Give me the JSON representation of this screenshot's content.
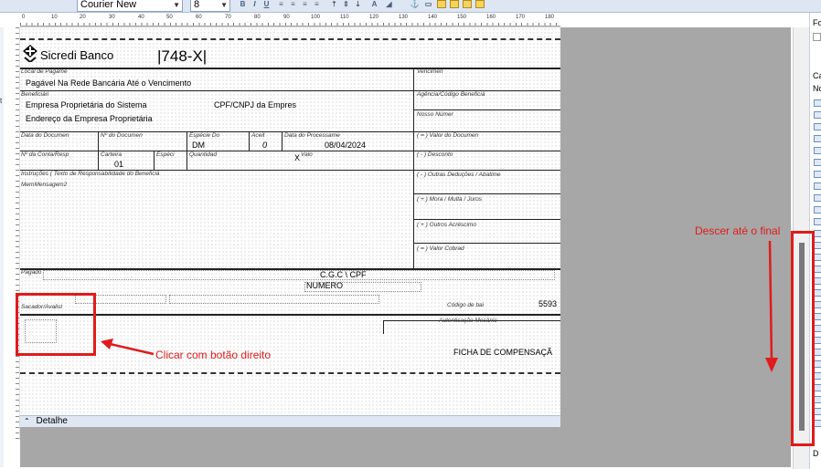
{
  "toolbar": {
    "font_name": "Courier New",
    "font_size": "8",
    "buttons": [
      "B",
      "I",
      "U"
    ]
  },
  "ruler": {
    "horizontal_ticks": [
      "0",
      "10",
      "20",
      "30",
      "40",
      "50",
      "60",
      "70",
      "80",
      "90",
      "100",
      "110",
      "120",
      "130",
      "140",
      "150",
      "160",
      "170",
      "180",
      "190",
      "200"
    ]
  },
  "boleto": {
    "bank_name": "Sicredi Banco",
    "bank_code": "|748-X|",
    "local_pagamento_label": "Local de Pagame",
    "local_pagamento_value": "Pagável Na Rede Bancária Até o Vencimento",
    "vencimento_label": "Vencimen",
    "beneficiario_label": "Beneficiári",
    "beneficiario_value": "Empresa Proprietária do Sistema",
    "cpf_cnpj_value": "CPF/CNPJ da Empres",
    "agencia_label": "Agência/Código Beneficiá",
    "endereco_value": "Endereço da Empresa Proprietária",
    "nosso_numero_label": "Nosso Númer",
    "data_documento_label": "Data do Documen",
    "num_documento_label": "Nº do Documen",
    "especie_doc_label": "Espécie Do",
    "especie_doc_value": "DM",
    "aceite_label": "Aceit",
    "aceite_value": "0",
    "data_processamento_label": "Data do Processame",
    "data_processamento_value": "08/04/2024",
    "valor_documento_label": "( = ) Valor do Documen",
    "conta_label": "Nº da Conta/Resp",
    "carteira_label": "Carteira",
    "carteira_value": "01",
    "especie_label": "Espéci",
    "quantidade_label": "Quantidad",
    "valor_label": "Valo",
    "valor_x": "X",
    "desconto_label": "( - ) Desconto",
    "instrucoes_label": "Instruções   ( Texto de Responsabilidade do Beneficiá",
    "mem_mensagem": "MemMensagem2",
    "outras_deducoes_label": "( - ) Outras Deduções / Abatime",
    "mora_label": "( + ) Mora / Multa / Juros",
    "outros_acrescimos_label": "( + ) Outros Acréscimo",
    "valor_cobrado_label": "( = ) Valor Cobrad",
    "pagador_label": "Pagado",
    "cgc_cpf_value": "C.G.C \\ CPF",
    "numero_value": "NUMERO",
    "codigo_baixa_label": "Código de bai",
    "codigo_baixa_value": "5593",
    "sacador_label": "Sacador/Avalist",
    "autenticacao_label": "Autenticação Mecânic",
    "ficha_label": "FICHA DE COMPENSAÇÃ"
  },
  "band": {
    "name": "Detalhe"
  },
  "right_panel": {
    "tab_1": "Fo",
    "tab_2": "Ca",
    "tab_3": "No",
    "tab_4": "D"
  },
  "annotations": {
    "right_click_text": "Clicar com botão direito",
    "scroll_text": "Descer até o final",
    "color": "#e01b1b"
  }
}
